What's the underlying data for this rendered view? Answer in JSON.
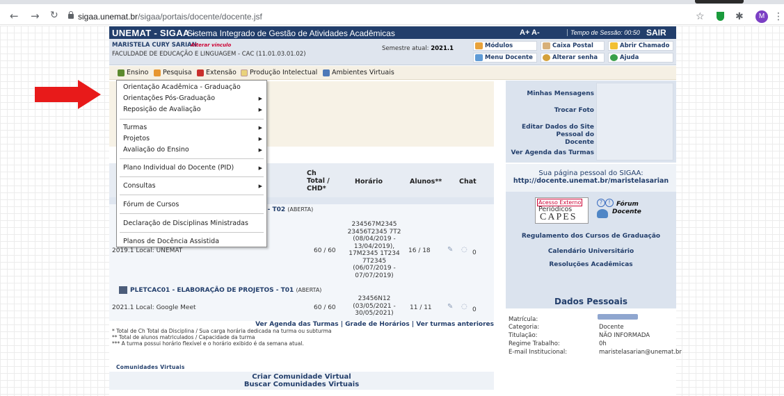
{
  "browser": {
    "url_host": "sigaa.unemat.br",
    "url_path": "/sigaa/portais/docente/docente.jsf",
    "profile_initial": "M"
  },
  "header": {
    "system_name": "UNEMAT - SIGAA -",
    "system_subtitle": "Sistema Integrado de Gestão de Atividades Acadêmicas",
    "font_controls": "A+ A-",
    "session_time": "Tempo de Sessão: 00:50",
    "logout": "SAIR"
  },
  "user": {
    "name": "MARISTELA CURY SARIAN",
    "alter_link": "Alterar vínculo",
    "faculty": "FACULDADE DE EDUCAÇÃO E LINGUAGEM - CAC (11.01.03.01.02)",
    "semester_label": "Semestre atual:",
    "semester_value": "2021.1"
  },
  "quick_links": {
    "modulos": "Módulos",
    "caixa_postal": "Caixa Postal",
    "abrir_chamado": "Abrir Chamado",
    "menu_docente": "Menu Docente",
    "alterar_senha": "Alterar senha",
    "ajuda": "Ajuda"
  },
  "menubar": {
    "ensino": "Ensino",
    "pesquisa": "Pesquisa",
    "extensao": "Extensão",
    "producao": "Produção Intelectual",
    "ambientes": "Ambientes Virtuais"
  },
  "dropdown": {
    "items": [
      "Orientação Acadêmica - Graduação",
      "Orientações Pós-Graduação",
      "Reposição de Avaliação",
      "Turmas",
      "Projetos",
      "Avaliação do Ensino",
      "Plano Individual do Docente (PID)",
      "Consultas",
      "Fórum de Cursos",
      "Declaração de Disciplinas Ministradas",
      "Planos de Docência Assistida"
    ]
  },
  "table": {
    "col_ch": "Ch",
    "col_total": "Total /",
    "col_chd": "CHD*",
    "col_horario": "Horário",
    "col_alunos": "Alunos**",
    "col_chat": "Chat",
    "course1_tail": "S - T02",
    "course1_status": "(ABERTA)",
    "course1_local": "2019.1 Local: UNEMAT",
    "course1_ch": "60 / 60",
    "course1_horario": [
      "234567M2345",
      "23456T2345 7T2",
      "(08/04/2019 -",
      "13/04/2019),",
      "17M2345 1T234",
      "7T2345",
      "(06/07/2019 -",
      "07/07/2019)"
    ],
    "course1_alunos": "16 / 18",
    "course1_chat": "0",
    "course2_title": "PLETCAC01 - ELABORAÇÃO DE PROJETOS - T01",
    "course2_status": "(ABERTA)",
    "course2_local": "2021.1 Local: Google Meet",
    "course2_ch": "60 / 60",
    "course2_horario": [
      "23456N12",
      "(03/05/2021 -",
      "30/05/2021)"
    ],
    "course2_alunos": "11 / 11",
    "course2_chat": "0"
  },
  "table_links": "Ver Agenda das Turmas | Grade de Horários | Ver turmas anteriores",
  "footnotes": [
    "* Total de Ch Total da Disciplina / Sua carga horária dedicada na turma ou subturma",
    "** Total de alunos matriculados / Capacidade da turma",
    "*** A turma possui horário flexível e o horário exibido é da semana atual."
  ],
  "comunidades": {
    "title": "Comunidades Virtuais",
    "criar": "Criar Comunidade Virtual",
    "buscar": "Buscar Comunidades Virtuais"
  },
  "right": {
    "minhas_mensagens": "Minhas Mensagens",
    "trocar_foto": "Trocar Foto",
    "editar_dados_1": "Editar Dados do Site Pessoal do",
    "editar_dados_2": "Docente",
    "ver_agenda": "Ver Agenda das Turmas",
    "pagina_pessoal": "Sua página pessoal do SIGAA:",
    "pagina_url": "http://docente.unemat.br/maristelasarian",
    "banner_capes_1": "Acesso Externo",
    "banner_capes_2": "Periódicos",
    "banner_capes_3": "CAPES",
    "banner_forum_1": "Fórum",
    "banner_forum_2": "Docente",
    "regulamento": "Regulamento dos Cursos de Graduação",
    "calendario": "Calendário Universitário",
    "resolucoes": "Resoluções Acadêmicas",
    "dados_title": "Dados Pessoais",
    "dados": {
      "matricula_label": "Matrícula:",
      "categoria_label": "Categoria:",
      "categoria_value": "Docente",
      "titulacao_label": "Titulação:",
      "titulacao_value": "NÃO INFORMADA",
      "regime_label": "Regime Trabalho:",
      "regime_value": "0h",
      "email_label": "E-mail Institucional:",
      "email_value": "maristelasarian@unemat.br"
    }
  },
  "colors": {
    "header_bg": "#223e6b",
    "accent_red": "#e81a1a",
    "link_blue": "#223e6b"
  }
}
